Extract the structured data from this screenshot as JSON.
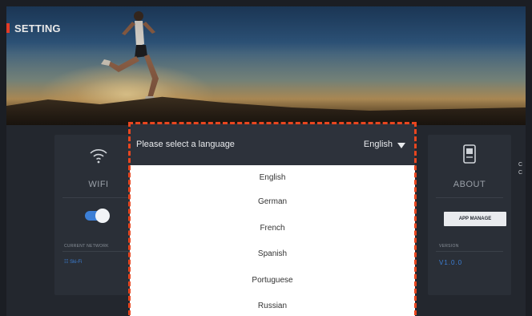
{
  "page": {
    "title": "SETTING"
  },
  "colors": {
    "accent": "#e53b26",
    "highlight_frame": "#e8461f",
    "toggle_on": "#3c7fd6",
    "card_bg": "#2a2f37"
  },
  "wifi_card": {
    "icon": "wifi-icon",
    "title": "WIFI",
    "toggle_on": true,
    "current_network_label": "CURRENT NETWORK",
    "network_name": "Ski-Fi"
  },
  "about_card": {
    "icon": "device-icon",
    "title": "ABOUT",
    "app_manage_label": "APP MANAGE",
    "version_label": "VERSION",
    "version_value": "V1.0.0"
  },
  "edge_text": [
    "C",
    "C"
  ],
  "language_dialog": {
    "prompt": "Please select a language",
    "selected": "English",
    "options": [
      "English",
      "German",
      "French",
      "Spanish",
      "Portuguese",
      "Russian"
    ]
  }
}
